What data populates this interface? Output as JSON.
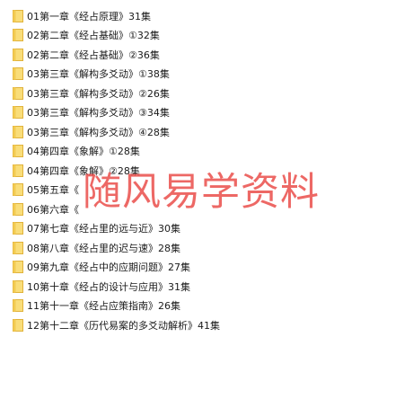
{
  "colors": {
    "folder_fill": "#f9dd79",
    "folder_edge": "#e0b23c",
    "watermark": "#e83e3a"
  },
  "files": [
    {
      "icon": "folder-icon",
      "name": "01第一章《经占原理》31集"
    },
    {
      "icon": "folder-icon",
      "name": "02第二章《经占基础》①32集"
    },
    {
      "icon": "folder-icon",
      "name": "02第二章《经占基础》②36集"
    },
    {
      "icon": "folder-icon",
      "name": "03第三章《解构多爻动》①38集"
    },
    {
      "icon": "folder-icon",
      "name": "03第三章《解构多爻动》②26集"
    },
    {
      "icon": "folder-icon",
      "name": "03第三章《解构多爻动》③34集"
    },
    {
      "icon": "folder-icon",
      "name": "03第三章《解构多爻动》④28集"
    },
    {
      "icon": "folder-icon",
      "name": "04第四章《象解》①28集"
    },
    {
      "icon": "folder-icon",
      "name": "04第四章《象解》②28集"
    },
    {
      "icon": "folder-icon",
      "name": "05第五章《"
    },
    {
      "icon": "folder-icon",
      "name": "06第六章《"
    },
    {
      "icon": "folder-icon",
      "name": "07第七章《经占里的远与近》30集"
    },
    {
      "icon": "folder-icon",
      "name": "08第八章《经占里的迟与速》28集"
    },
    {
      "icon": "folder-icon",
      "name": "09第九章《经占中的应期问题》27集"
    },
    {
      "icon": "folder-icon",
      "name": "10第十章《经占的设计与应用》31集"
    },
    {
      "icon": "folder-icon",
      "name": "11第十一章《经占应策指南》26集"
    },
    {
      "icon": "folder-icon",
      "name": "12第十二章《历代易案的多爻动解析》41集"
    }
  ],
  "watermark": "随风易学资料"
}
